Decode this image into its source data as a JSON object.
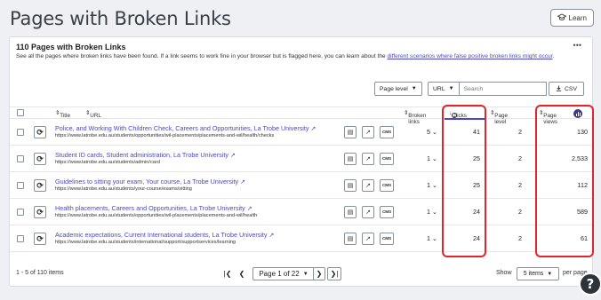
{
  "page": {
    "title": "Pages with Broken Links",
    "learn_label": "Learn"
  },
  "card": {
    "title": "110 Pages with Broken Links",
    "desc_text": "See all the pages where broken links have been found. If a link seems to work fine in your browser but is flagged here, you can learn about the ",
    "desc_link": "different scenarios where false positive broken links might occur",
    "desc_end": ".",
    "more": "•••"
  },
  "toolbar": {
    "filter1": "Page level",
    "filter2": "URL",
    "search_placeholder": "Search",
    "csv_label": "CSV"
  },
  "columns": {
    "title": "Title",
    "url": "URL",
    "broken": "Broken links",
    "clicks": "Clicks",
    "level": "Page level",
    "views": "Page views"
  },
  "rows": [
    {
      "title": "Police, and Working With Children Check, Careers and Opportunities, La Trobe University",
      "url": "https://www.latrobe.edu.au/students/opportunities/wil-placements/placements-and-wil/health/checks",
      "broken": "5",
      "clicks": "41",
      "level": "2",
      "views": "130"
    },
    {
      "title": "Student ID cards, Student administration, La Trobe University",
      "url": "https://www.latrobe.edu.au/students/admin/card",
      "broken": "1",
      "clicks": "25",
      "level": "2",
      "views": "2,533"
    },
    {
      "title": "Guidelines to sitting your exam, Your course, La Trobe University",
      "url": "https://www.latrobe.edu.au/students/your-course/exams/sitting",
      "broken": "1",
      "clicks": "25",
      "level": "2",
      "views": "112"
    },
    {
      "title": "Health placements, Careers and Opportunities, La Trobe University",
      "url": "https://www.latrobe.edu.au/students/opportunities/wil-placements/placements-and-wil/health",
      "broken": "1",
      "clicks": "24",
      "level": "2",
      "views": "589"
    },
    {
      "title": "Academic expectations, Current International students, La Trobe University",
      "url": "https://www.latrobe.edu.au/students/international/support/supportservices/learning",
      "broken": "1",
      "clicks": "24",
      "level": "2",
      "views": "61"
    }
  ],
  "footer": {
    "range": "1 - 5 of 110 items",
    "page_label": "Page 1 of 22",
    "show_label": "Show",
    "per_page_value": "5 items",
    "per_page_suffix": "per page"
  },
  "colors": {
    "link": "#4a47c8",
    "highlight": "#e0262a"
  },
  "icons": [
    "mortarboard-icon",
    "refresh-icon",
    "inspect-icon",
    "external-link-icon",
    "cms-icon",
    "chevron-down-icon",
    "download-icon",
    "info-icon",
    "help-icon"
  ]
}
